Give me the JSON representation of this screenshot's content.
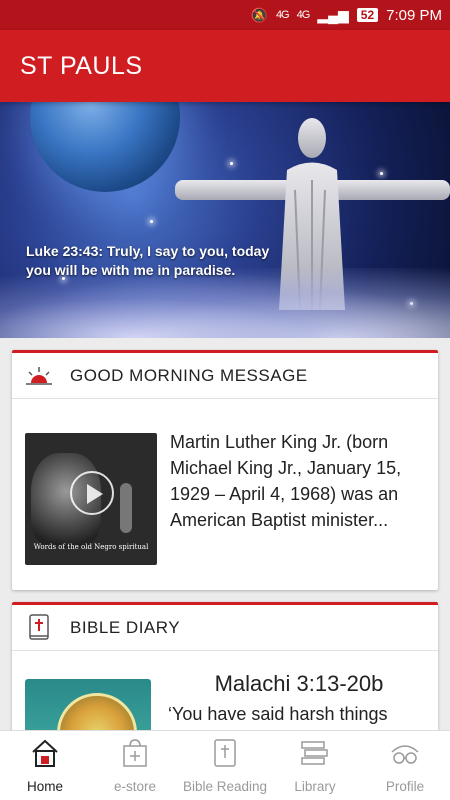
{
  "status_bar": {
    "network_left": "4G",
    "network_right": "4G",
    "battery": "52",
    "time": "7:09 PM"
  },
  "app_bar": {
    "title": "ST PAULS"
  },
  "banner": {
    "verse": "Luke 23:43: Truly, I say to you, today you will be with me in paradise."
  },
  "good_morning": {
    "heading": "GOOD MORNING MESSAGE",
    "video_caption": "Words of the old Negro spiritual",
    "snippet": "Martin Luther King Jr. (born Michael King Jr., January 15, 1929 – April 4, 1968) was an American Baptist minister..."
  },
  "bible_diary": {
    "heading": "BIBLE DIARY",
    "reference": "Malachi 3:13-20b",
    "text": "‘You have said harsh things about me'"
  },
  "bottom_nav": {
    "items": [
      {
        "label": "Home",
        "icon": "home-icon",
        "active": true
      },
      {
        "label": "e-store",
        "icon": "shopping-bag-icon",
        "active": false
      },
      {
        "label": "Bible Reading",
        "icon": "bible-icon",
        "active": false
      },
      {
        "label": "Library",
        "icon": "books-icon",
        "active": false
      },
      {
        "label": "Profile",
        "icon": "profile-icon",
        "active": false
      }
    ]
  },
  "colors": {
    "primary": "#d01d22",
    "status_bar": "#b3131a"
  }
}
